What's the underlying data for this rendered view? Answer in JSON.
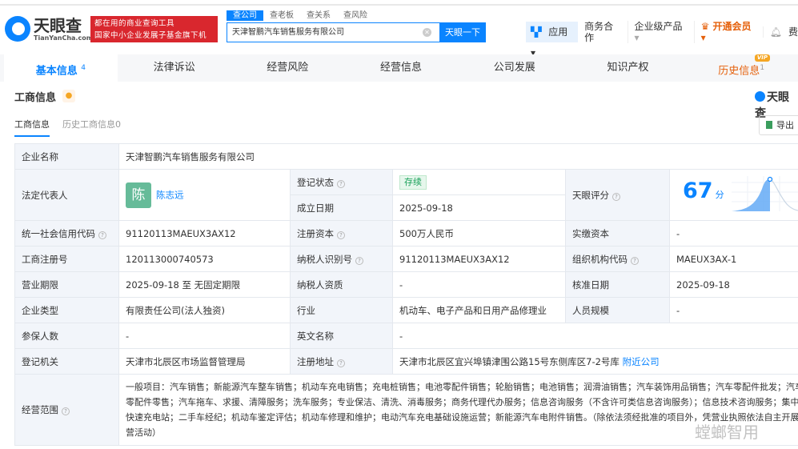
{
  "header": {
    "logo_cn": "天眼查",
    "logo_en": "TianYanCha.com",
    "slogan_line1": "都在用的商业查询工具",
    "slogan_line2": "国家中小企业发展子基金旗下机构",
    "search_tabs": [
      "查公司",
      "查老板",
      "查关系",
      "查风险"
    ],
    "search_value": "天津智鹏汽车销售服务有限公司",
    "search_button": "天眼一下",
    "nav": {
      "app": "应用",
      "biz": "商务合作",
      "enterprise": "企业级产品",
      "vip": "开通会员",
      "more": "费"
    }
  },
  "tabs": [
    {
      "label": "基本信息",
      "count": "4"
    },
    {
      "label": "法律诉讼"
    },
    {
      "label": "经营风险"
    },
    {
      "label": "经营信息"
    },
    {
      "label": "公司发展"
    },
    {
      "label": "知识产权"
    },
    {
      "label": "历史信息",
      "count": "1",
      "badge": "VIP"
    }
  ],
  "section": {
    "title": "工商信息",
    "brand": "天眼查",
    "subtabs": [
      "工商信息",
      "历史工商信息0"
    ],
    "export": "导出"
  },
  "info": {
    "company_name_label": "企业名称",
    "company_name": "天津智鹏汽车销售服务有限公司",
    "legal_rep_label": "法定代表人",
    "legal_rep_avatar": "陈",
    "legal_rep": "陈志远",
    "reg_status_label": "登记状态",
    "reg_status": "存续",
    "founded_label": "成立日期",
    "founded": "2025-09-18",
    "score_label": "天眼评分",
    "score": "67",
    "score_unit": "分",
    "credit_code_label": "统一社会信用代码",
    "credit_code": "91120113MAEUX3AX12",
    "reg_capital_label": "注册资本",
    "reg_capital": "500万人民币",
    "paid_capital_label": "实缴资本",
    "paid_capital": "-",
    "reg_no_label": "工商注册号",
    "reg_no": "120113000740573",
    "tax_id_label": "纳税人识别号",
    "tax_id": "91120113MAEUX3AX12",
    "org_code_label": "组织机构代码",
    "org_code": "MAEUX3AX-1",
    "term_label": "营业期限",
    "term": "2025-09-18 至 无固定期限",
    "taxpayer_label": "纳税人资质",
    "taxpayer": "-",
    "approve_label": "核准日期",
    "approve": "2025-09-18",
    "type_label": "企业类型",
    "type": "有限责任公司(法人独资)",
    "industry_label": "行业",
    "industry": "机动车、电子产品和日用产品修理业",
    "staff_label": "人员规模",
    "staff": "-",
    "insured_label": "参保人数",
    "insured": "-",
    "en_name_label": "英文名称",
    "en_name": "-",
    "authority_label": "登记机关",
    "authority": "天津市北辰区市场监督管理局",
    "address_label": "注册地址",
    "address": "天津市北辰区宜兴埠镇津围公路15号东侧库区7-2号库",
    "nearby": "附近公司",
    "scope_label": "经营范围",
    "scope": "一般项目：汽车销售；新能源汽车整车销售；机动车充电销售；充电桩销售；电池零配件销售；轮胎销售；电池销售；润滑油销售；汽车装饰用品销售；汽车零配件批发；汽车零配件零售；汽车拖车、求援、清障服务；洗车服务；专业保洁、清洗、消毒服务；商务代理代办服务；信息咨询服务（不含许可类信息咨询服务）；信息技术咨询服务；集中式快速充电站；二手车经纪；机动车鉴定评估；机动车修理和维护；电动汽车充电基础设施运营；新能源汽车电附件销售。（除依法须经批准的项目外，凭营业执照依法自主开展经营活动）"
  },
  "watermark": "螳螂智用"
}
